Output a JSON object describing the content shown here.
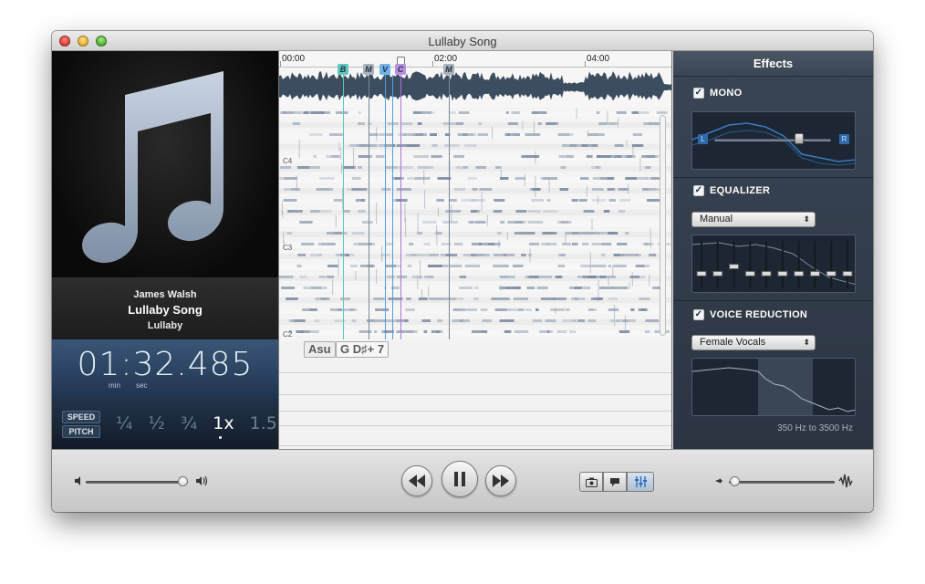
{
  "window": {
    "title": "Lullaby Song"
  },
  "track": {
    "artist": "James Walsh",
    "song": "Lullaby Song",
    "album": "Lullaby"
  },
  "time": {
    "display": "01:32.485",
    "unit_min": "min",
    "unit_sec": "sec"
  },
  "rate_controls": {
    "speed_label": "SPEED",
    "pitch_label": "PITCH",
    "options": [
      "¼",
      "½",
      "¾",
      "1x",
      "1.5"
    ],
    "selected": "1x"
  },
  "timeline": {
    "labels": [
      "00:00",
      "02:00",
      "04:00"
    ]
  },
  "markers": [
    {
      "label": "B",
      "color": "#5fc6c0"
    },
    {
      "label": "M",
      "color": "#a7b2bd"
    },
    {
      "label": "V",
      "color": "#6fb3e8"
    },
    {
      "label": "C",
      "color": "#b98fe0"
    },
    {
      "label": "M",
      "color": "#a7b2bd"
    }
  ],
  "note_labels": [
    "C4",
    "C3",
    "C2"
  ],
  "chords": {
    "first": "Asu",
    "second": "G D♯+ 7"
  },
  "effects": {
    "title": "Effects",
    "mono": {
      "label": "MONO",
      "checked": true,
      "left": "L",
      "right": "R"
    },
    "equalizer": {
      "label": "EQUALIZER",
      "checked": true,
      "preset": "Manual",
      "band_levels": [
        0.3,
        0.3,
        0.45,
        0.3,
        0.3,
        0.3,
        0.3,
        0.3,
        0.3,
        0.3
      ]
    },
    "voice_reduction": {
      "label": "VOICE REDUCTION",
      "checked": true,
      "preset": "Female Vocals",
      "range": "350 Hz to 3500 Hz"
    }
  },
  "colors": {
    "accent": "#3f5f80",
    "panel": "#33404e",
    "waveform": "#3c4d60"
  },
  "bottom": {
    "volume_level": 0.95,
    "mix_level": 0.05
  }
}
